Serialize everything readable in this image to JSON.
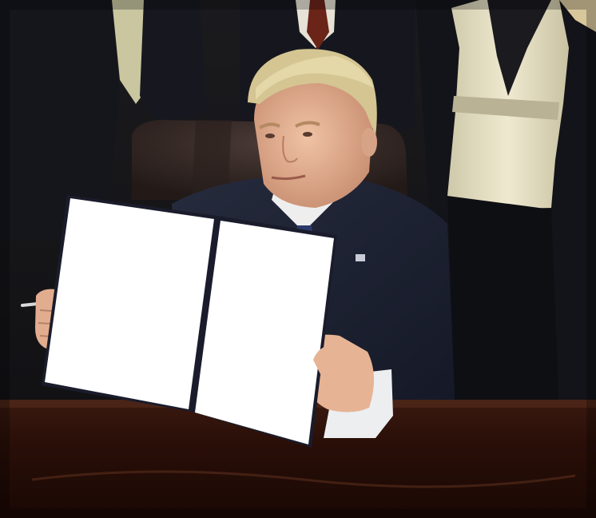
{
  "scene": {
    "subject": "",
    "colors": {
      "background": "#1a1a1c",
      "suit": "#1d2233",
      "hair": "#d2c28e",
      "skin": "#e9b79a",
      "paper": "#ffffff",
      "folder": "#1a1c2c",
      "desk": "#2a0f08",
      "blouse": "#e6e0c4",
      "chair": "#3a2c2a"
    }
  }
}
